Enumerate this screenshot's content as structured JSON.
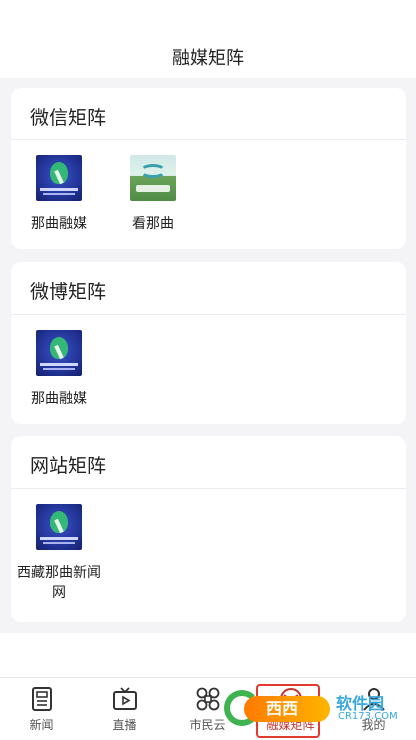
{
  "header": {
    "title": "融媒矩阵"
  },
  "sections": [
    {
      "title": "微信矩阵",
      "items": [
        {
          "label": "那曲融媒",
          "logo": "naqu-media-logo"
        },
        {
          "label": "看那曲",
          "logo": "kan-naqu-logo"
        }
      ]
    },
    {
      "title": "微博矩阵",
      "items": [
        {
          "label": "那曲融媒",
          "logo": "naqu-media-logo"
        }
      ]
    },
    {
      "title": "网站矩阵",
      "items": [
        {
          "label_line1": "西藏那曲新闻",
          "label_line2": "网",
          "logo": "naqu-media-logo"
        }
      ]
    }
  ],
  "tabbar": {
    "tabs": [
      {
        "label": "新闻",
        "icon": "newspaper-icon"
      },
      {
        "label": "直播",
        "icon": "tv-play-icon"
      },
      {
        "label": "市民云",
        "icon": "command-icon"
      },
      {
        "label": "融媒矩阵",
        "icon": "matrix-icon",
        "active": true
      },
      {
        "label": "我的",
        "icon": "person-icon"
      }
    ]
  },
  "watermark": {
    "brand": "西西",
    "soft": "软件园",
    "url": "CR173.COM"
  },
  "colors": {
    "accent": "#c8332b",
    "background": "#f4f4f6",
    "card": "#ffffff"
  }
}
